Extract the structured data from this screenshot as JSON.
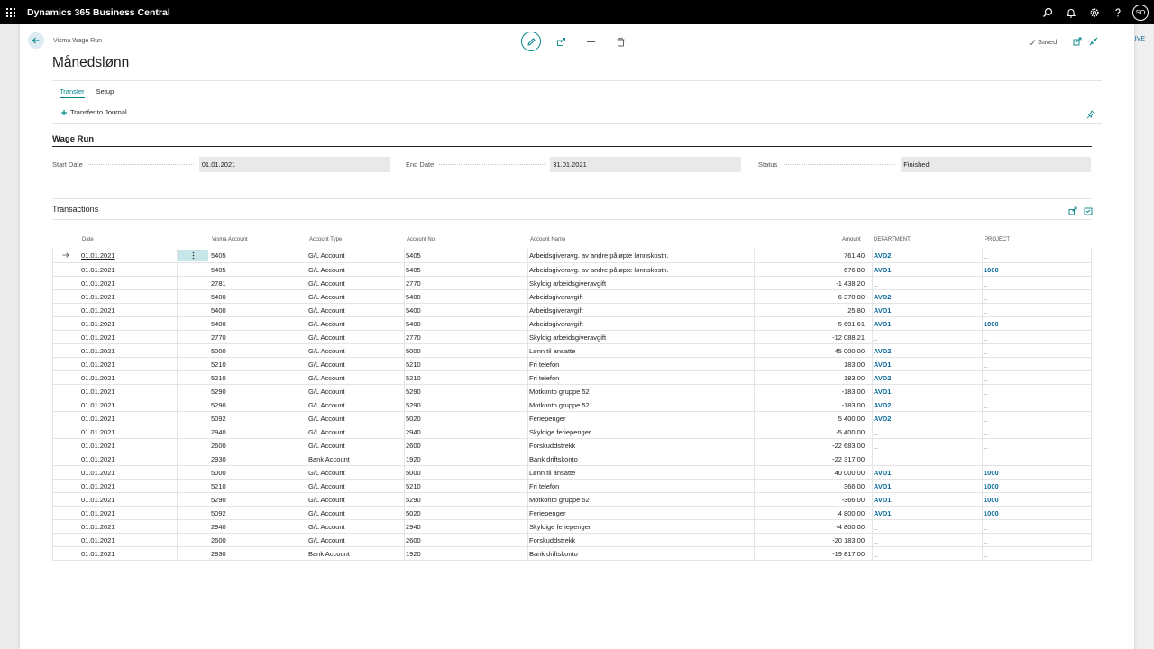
{
  "topbar": {
    "app_title": "Dynamics 365 Business Central",
    "avatar_initials": "SO"
  },
  "env_badge": "LIVE",
  "page": {
    "breadcrumb": "Visma Wage Run",
    "title": "Månedslønn",
    "saved_label": "Saved"
  },
  "tabs": [
    {
      "label": "Transfer",
      "active": true
    },
    {
      "label": "Setup",
      "active": false
    }
  ],
  "actions": {
    "transfer_to_journal": "Transfer to Journal"
  },
  "wage_run": {
    "section_title": "Wage Run",
    "start_date_label": "Start Date",
    "start_date": "01.01.2021",
    "end_date_label": "End Date",
    "end_date": "31.01.2021",
    "status_label": "Status",
    "status": "Finished"
  },
  "transactions": {
    "section_title": "Transactions",
    "columns": {
      "date": "Date",
      "visma_account": "Visma Account",
      "account_type": "Account Type",
      "account_no": "Account No.",
      "account_name": "Account Name",
      "amount": "Amount",
      "department": "DEPARTMENT",
      "project": "PROJECT"
    },
    "rows": [
      {
        "date": "01.01.2021",
        "visma": "5405",
        "type": "G/L Account",
        "no": "5405",
        "name": "Arbeidsgiveravg. av andre påløpte lønnskostn.",
        "amount": "761,40",
        "dept": "AVD2",
        "project": "_"
      },
      {
        "date": "01.01.2021",
        "visma": "5405",
        "type": "G/L Account",
        "no": "5405",
        "name": "Arbeidsgiveravg. av andre påløpte lønnskostn.",
        "amount": "676,80",
        "dept": "AVD1",
        "project": "1000"
      },
      {
        "date": "01.01.2021",
        "visma": "2781",
        "type": "G/L Account",
        "no": "2770",
        "name": "Skyldig arbeidsgiveravgift",
        "amount": "-1 438,20",
        "dept": "_",
        "project": "_"
      },
      {
        "date": "01.01.2021",
        "visma": "5400",
        "type": "G/L Account",
        "no": "5400",
        "name": "Arbeidsgiveravgift",
        "amount": "6 370,80",
        "dept": "AVD2",
        "project": "_"
      },
      {
        "date": "01.01.2021",
        "visma": "5400",
        "type": "G/L Account",
        "no": "5400",
        "name": "Arbeidsgiveravgift",
        "amount": "25,80",
        "dept": "AVD1",
        "project": "_"
      },
      {
        "date": "01.01.2021",
        "visma": "5400",
        "type": "G/L Account",
        "no": "5400",
        "name": "Arbeidsgiveravgift",
        "amount": "5 691,61",
        "dept": "AVD1",
        "project": "1000"
      },
      {
        "date": "01.01.2021",
        "visma": "2770",
        "type": "G/L Account",
        "no": "2770",
        "name": "Skyldig arbeidsgiveravgift",
        "amount": "-12 088,21",
        "dept": "_",
        "project": "_"
      },
      {
        "date": "01.01.2021",
        "visma": "5000",
        "type": "G/L Account",
        "no": "5000",
        "name": "Lønn til ansatte",
        "amount": "45 000,00",
        "dept": "AVD2",
        "project": "_"
      },
      {
        "date": "01.01.2021",
        "visma": "5210",
        "type": "G/L Account",
        "no": "5210",
        "name": "Fri telefon",
        "amount": "183,00",
        "dept": "AVD1",
        "project": "_"
      },
      {
        "date": "01.01.2021",
        "visma": "5210",
        "type": "G/L Account",
        "no": "5210",
        "name": "Fri telefon",
        "amount": "183,00",
        "dept": "AVD2",
        "project": "_"
      },
      {
        "date": "01.01.2021",
        "visma": "5290",
        "type": "G/L Account",
        "no": "5290",
        "name": "Motkonto gruppe 52",
        "amount": "-183,00",
        "dept": "AVD1",
        "project": "_"
      },
      {
        "date": "01.01.2021",
        "visma": "5290",
        "type": "G/L Account",
        "no": "5290",
        "name": "Motkonto gruppe 52",
        "amount": "-183,00",
        "dept": "AVD2",
        "project": "_"
      },
      {
        "date": "01.01.2021",
        "visma": "5092",
        "type": "G/L Account",
        "no": "5020",
        "name": "Feriepenger",
        "amount": "5 400,00",
        "dept": "AVD2",
        "project": "_"
      },
      {
        "date": "01.01.2021",
        "visma": "2940",
        "type": "G/L Account",
        "no": "2940",
        "name": "Skyldige feriepenger",
        "amount": "-5 400,00",
        "dept": "_",
        "project": "_"
      },
      {
        "date": "01.01.2021",
        "visma": "2600",
        "type": "G/L Account",
        "no": "2600",
        "name": "Forskuddstrekk",
        "amount": "-22 683,00",
        "dept": "_",
        "project": "_"
      },
      {
        "date": "01.01.2021",
        "visma": "2930",
        "type": "Bank Account",
        "no": "1920",
        "name": "Bank driftskonto",
        "amount": "-22 317,00",
        "dept": "_",
        "project": "_"
      },
      {
        "date": "01.01.2021",
        "visma": "5000",
        "type": "G/L Account",
        "no": "5000",
        "name": "Lønn til ansatte",
        "amount": "40 000,00",
        "dept": "AVD1",
        "project": "1000"
      },
      {
        "date": "01.01.2021",
        "visma": "5210",
        "type": "G/L Account",
        "no": "5210",
        "name": "Fri telefon",
        "amount": "366,00",
        "dept": "AVD1",
        "project": "1000"
      },
      {
        "date": "01.01.2021",
        "visma": "5290",
        "type": "G/L Account",
        "no": "5290",
        "name": "Motkonto gruppe 52",
        "amount": "-366,00",
        "dept": "AVD1",
        "project": "1000"
      },
      {
        "date": "01.01.2021",
        "visma": "5092",
        "type": "G/L Account",
        "no": "5020",
        "name": "Feriepenger",
        "amount": "4 800,00",
        "dept": "AVD1",
        "project": "1000"
      },
      {
        "date": "01.01.2021",
        "visma": "2940",
        "type": "G/L Account",
        "no": "2940",
        "name": "Skyldige feriepenger",
        "amount": "-4 800,00",
        "dept": "_",
        "project": "_"
      },
      {
        "date": "01.01.2021",
        "visma": "2600",
        "type": "G/L Account",
        "no": "2600",
        "name": "Forskuddstrekk",
        "amount": "-20 183,00",
        "dept": "_",
        "project": "_"
      },
      {
        "date": "01.01.2021",
        "visma": "2930",
        "type": "Bank Account",
        "no": "1920",
        "name": "Bank driftskonto",
        "amount": "-19 817,00",
        "dept": "_",
        "project": "_"
      }
    ]
  },
  "colors": {
    "accent": "#008489",
    "link": "#0b6a9b",
    "selected_cell": "#c7e6ea"
  }
}
